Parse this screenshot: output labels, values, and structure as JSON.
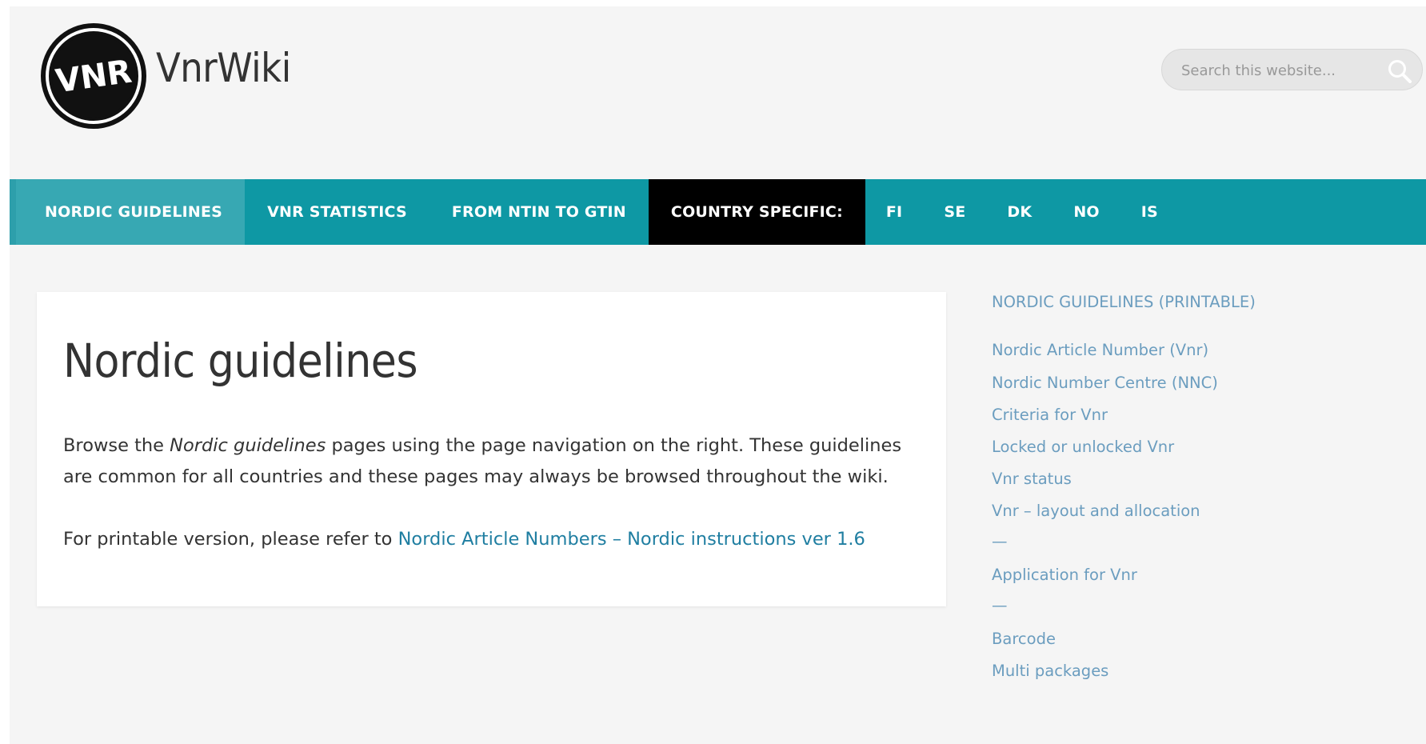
{
  "header": {
    "logo_text": "VNR",
    "site_title": "VnrWiki",
    "search": {
      "placeholder": "Search this website..."
    }
  },
  "nav": {
    "items": [
      {
        "label": "NORDIC GUIDELINES"
      },
      {
        "label": "VNR STATISTICS"
      },
      {
        "label": "FROM NTIN TO GTIN"
      },
      {
        "label": "COUNTRY SPECIFIC:"
      },
      {
        "label": "FI"
      },
      {
        "label": "SE"
      },
      {
        "label": "DK"
      },
      {
        "label": "NO"
      },
      {
        "label": "IS"
      }
    ]
  },
  "content": {
    "title": "Nordic guidelines",
    "para1_before": "Browse the ",
    "para1_em": "Nordic guidelines",
    "para1_after": " pages using the page navigation on the right. These guidelines are common for all countries and these pages may always be browsed throughout the wiki.",
    "para2_before": "For printable version, please refer to ",
    "para2_link": "Nordic Article Numbers – Nordic instructions ver 1.6"
  },
  "sidebar": {
    "items": [
      "NORDIC GUIDELINES (PRINTABLE)",
      "Nordic Article Number (Vnr)",
      "Nordic Number Centre (NNC)",
      "Criteria for Vnr",
      "Locked or unlocked Vnr",
      "Vnr status",
      "Vnr – layout and allocation",
      "—",
      "Application for Vnr",
      "—",
      "Barcode",
      "Multi packages"
    ]
  },
  "colors": {
    "nav_bg": "#0e98a4",
    "nav_active": "#37a8b3",
    "nav_dark": "#000000",
    "link": "#1f7ea1",
    "sidebar_link": "#6b9dbf"
  }
}
